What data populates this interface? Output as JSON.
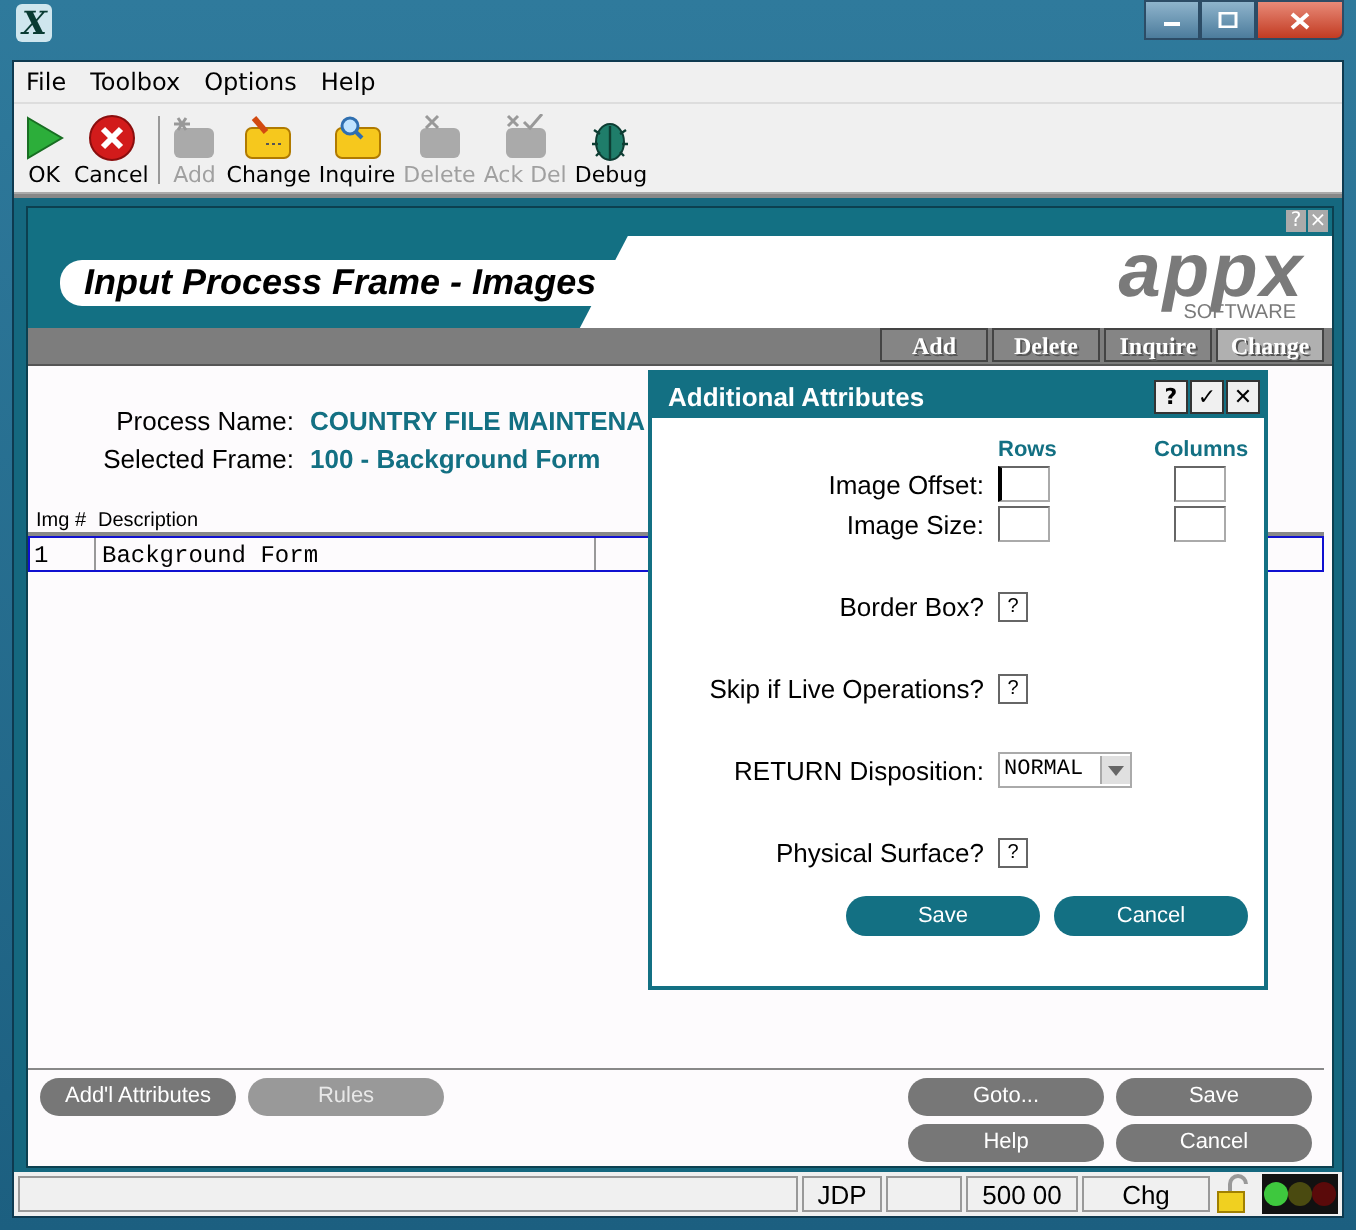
{
  "window": {
    "title_logo": "X"
  },
  "menu": [
    "File",
    "Toolbox",
    "Options",
    "Help"
  ],
  "toolbar": [
    {
      "label": "OK",
      "disabled": false
    },
    {
      "label": "Cancel",
      "disabled": false
    },
    {
      "label": "Add",
      "disabled": true
    },
    {
      "label": "Change",
      "disabled": false
    },
    {
      "label": "Inquire",
      "disabled": false
    },
    {
      "label": "Delete",
      "disabled": true
    },
    {
      "label": "Ack Del",
      "disabled": true
    },
    {
      "label": "Debug",
      "disabled": false
    }
  ],
  "frame": {
    "mini_buttons": [
      "?",
      "×"
    ],
    "title": "Input Process Frame - Images",
    "logo": "appx",
    "logo_tagline": "SOFTWARE",
    "tabs": [
      {
        "label": "Add",
        "selected": false
      },
      {
        "label": "Delete",
        "selected": false
      },
      {
        "label": "Inquire",
        "selected": false
      },
      {
        "label": "Change",
        "selected": true
      }
    ],
    "fields": [
      {
        "label": "Process Name:",
        "value": "COUNTRY FILE MAINTENA"
      },
      {
        "label": "Selected Frame:",
        "value": "100 - Background Form"
      }
    ],
    "table": {
      "columns": [
        "Img #",
        "Description"
      ],
      "rows": [
        {
          "img": "1",
          "description": "Background Form",
          "selected": true
        }
      ]
    },
    "left_buttons": [
      {
        "label": "Add'l Attributes",
        "disabled": false
      },
      {
        "label": "Rules",
        "disabled": true
      }
    ],
    "right_buttons": [
      {
        "label": "Goto..."
      },
      {
        "label": "Save"
      },
      {
        "label": "Help"
      },
      {
        "label": "Cancel"
      }
    ]
  },
  "dialog": {
    "title": "Additional Attributes",
    "title_buttons": [
      "?",
      "✓",
      "✕"
    ],
    "col_headers": [
      "Rows",
      "Columns"
    ],
    "pairs": [
      {
        "label": "Image Offset:"
      },
      {
        "label": "Image Size:"
      }
    ],
    "options": [
      {
        "kind": "check",
        "label": "Border Box?",
        "value": "?",
        "indeterminate": true
      },
      {
        "kind": "check",
        "label": "Skip if Live Operations?",
        "value": "?",
        "indeterminate": true
      },
      {
        "kind": "select",
        "label": "RETURN Disposition:",
        "value": "NORMAL"
      },
      {
        "kind": "check",
        "label": "Physical Surface?",
        "value": "?",
        "indeterminate": true
      }
    ],
    "buttons": [
      "Save",
      "Cancel"
    ]
  },
  "status_bar": [
    "JDP",
    "500 00",
    "Chg"
  ]
}
